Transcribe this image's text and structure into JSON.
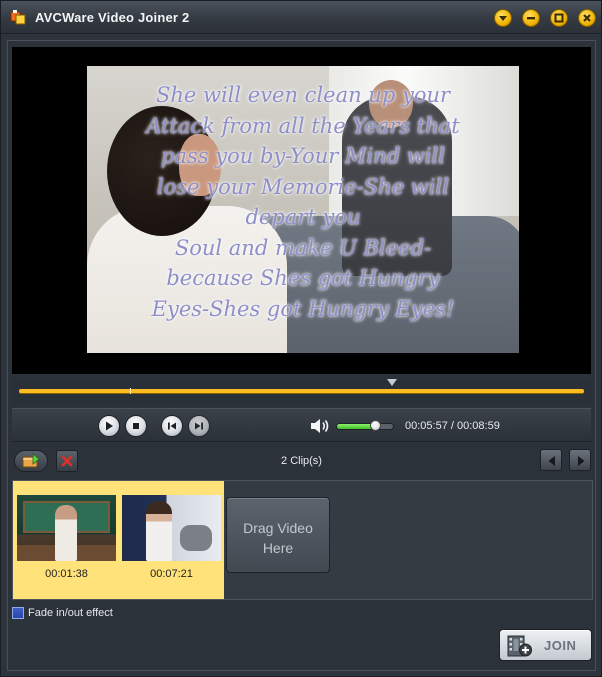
{
  "window": {
    "title": "AVCWare Video Joiner 2",
    "accent": "#ffbb22"
  },
  "preview": {
    "lyrics": [
      "She will even clean up your",
      "Attack from all the Years that",
      "pass you by-Your Mind will",
      "lose your Memorie-She will",
      "depart you",
      "Soul and make U Bleed-",
      "because Shes got Hungry",
      "Eyes-Shes got Hungry Eyes!"
    ]
  },
  "playback": {
    "current_time": "00:05:57",
    "total_time": "00:08:59",
    "time_separator": " / ",
    "volume_level": 0.68,
    "seek_position": 0.66
  },
  "toolbar": {
    "clip_count": "2 Clip(s)"
  },
  "clips": [
    {
      "duration": "00:01:38",
      "selected": true
    },
    {
      "duration": "00:07:21",
      "selected": true
    }
  ],
  "drop_zone": {
    "line1": "Drag Video",
    "line2": "Here"
  },
  "options": {
    "fade_label": "Fade in/out effect",
    "fade_checked": true
  },
  "join": {
    "label": "JOIN"
  },
  "icons": {
    "app": "app-logo-icon",
    "menu": "chevron-down-icon",
    "minimize": "minimize-icon",
    "maximize": "maximize-icon",
    "close": "close-icon",
    "play": "play-icon",
    "stop": "stop-icon",
    "prev": "skip-back-icon",
    "next": "skip-forward-icon",
    "volume": "volume-icon",
    "add": "add-file-icon",
    "delete": "delete-icon",
    "left": "arrow-left-icon",
    "right": "arrow-right-icon",
    "join": "film-join-icon"
  }
}
